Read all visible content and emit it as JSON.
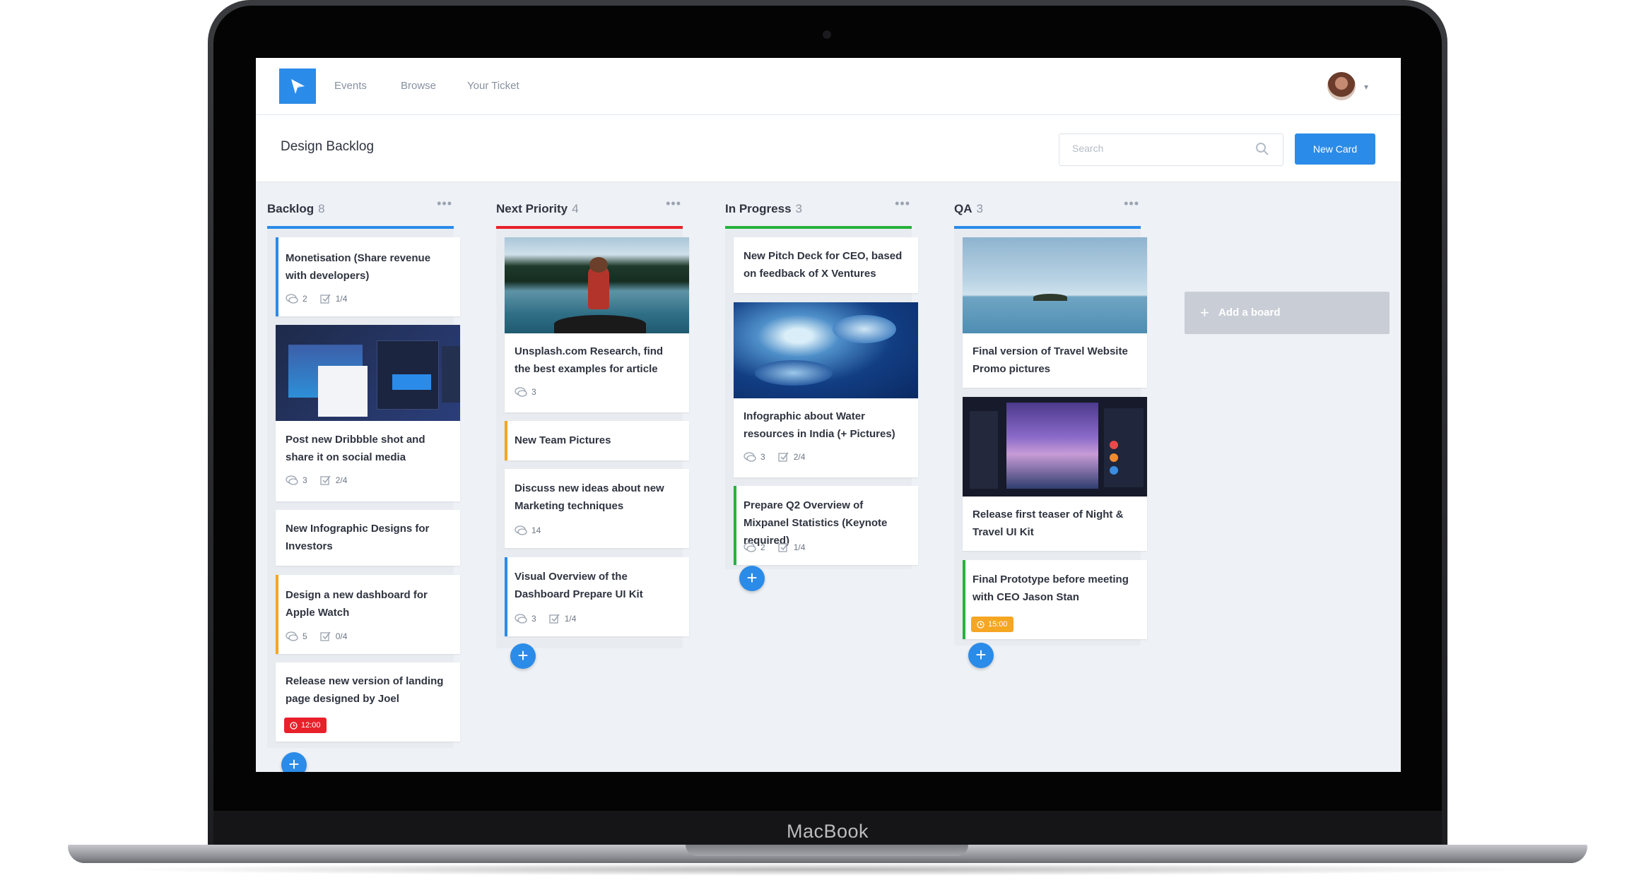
{
  "device": {
    "label": "MacBook"
  },
  "nav": {
    "links": [
      "Events",
      "Browse",
      "Your Ticket"
    ]
  },
  "header": {
    "title": "Design Backlog",
    "search_placeholder": "Search",
    "new_card_label": "New Card"
  },
  "columns": [
    {
      "title": "Backlog",
      "count": "8",
      "color": "#2b8be8",
      "cards": [
        {
          "title": "Monetisation (Share revenue with developers)",
          "comments": "2",
          "checklist": "1/4"
        },
        {
          "title": "Post new Dribbble shot and share it on social media",
          "comments": "3",
          "checklist": "2/4"
        },
        {
          "title": "New Infographic Designs for Investors"
        },
        {
          "title": "Design a new dashboard for Apple Watch",
          "comments": "5",
          "checklist": "0/4"
        },
        {
          "title": "Release new version of landing page designed by Joel",
          "badge": "12:00"
        }
      ]
    },
    {
      "title": "Next Priority",
      "count": "4",
      "color": "#e8202a",
      "cards": [
        {
          "title": "Unsplash.com Research, find the best examples for article",
          "comments": "3"
        },
        {
          "title": "New Team Pictures"
        },
        {
          "title": "Discuss new ideas about new Marketing techniques",
          "comments": "14"
        },
        {
          "title": "Visual Overview of the Dashboard Prepare UI Kit",
          "comments": "3",
          "checklist": "1/4"
        }
      ]
    },
    {
      "title": "In Progress",
      "count": "3",
      "color": "#27b23c",
      "cards": [
        {
          "title": "New Pitch Deck for CEO, based on feedback of X Ventures"
        },
        {
          "title": "Infographic about Water resources in India (+ Pictures)",
          "comments": "3",
          "checklist": "2/4"
        },
        {
          "title": "Prepare Q2 Overview of Mixpanel Statistics (Keynote required)",
          "comments": "2",
          "checklist": "1/4"
        }
      ]
    },
    {
      "title": "QA",
      "count": "3",
      "color": "#2b8be8",
      "cards": [
        {
          "title": "Final version of Travel Website Promo pictures"
        },
        {
          "title": "Release first teaser of Night & Travel UI Kit"
        },
        {
          "title": "Final Prototype before meeting with CEO Jason Stan",
          "badge": "15:00"
        }
      ]
    }
  ],
  "add_board_label": "Add a board",
  "colors": {
    "accent": "#2b8be8",
    "red": "#e8202a",
    "green": "#27b23c",
    "orange": "#f5a623",
    "badge_red": "#e8202a",
    "badge_orange": "#f5a623"
  }
}
